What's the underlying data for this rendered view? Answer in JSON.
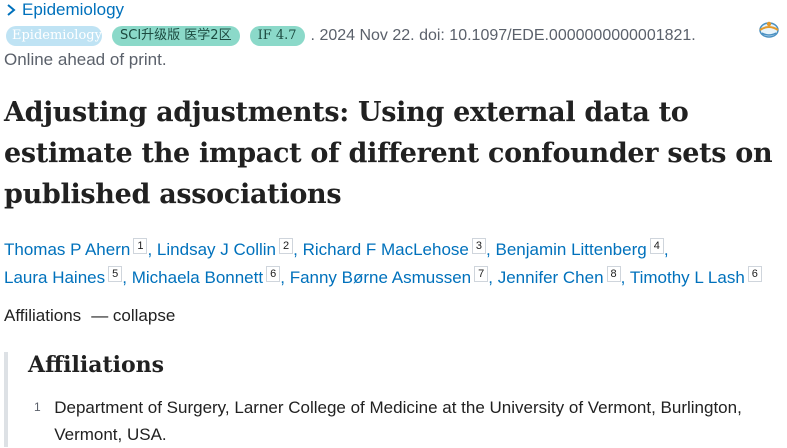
{
  "header": {
    "journal": "Epidemiology",
    "badges": {
      "journal": "Epidemiology",
      "sci": "SCI升级版 医学2区",
      "impact": "IF 4.7"
    },
    "citation": ". 2024 Nov 22. doi: 10.1097/EDE.0000000000001821.",
    "status": "Online ahead of print."
  },
  "article": {
    "title": "Adjusting adjustments: Using external data to estimate the impact of different confounder sets on published associations"
  },
  "authors": [
    {
      "name": "Thomas P Ahern",
      "aff": "1",
      "sep": ","
    },
    {
      "name": "Lindsay J Collin",
      "aff": "2",
      "sep": ","
    },
    {
      "name": "Richard F MacLehose",
      "aff": "3",
      "sep": ","
    },
    {
      "name": "Benjamin Littenberg",
      "aff": "4",
      "sep": ","
    },
    {
      "name": "Laura Haines",
      "aff": "5",
      "sep": ","
    },
    {
      "name": "Michaela Bonnett",
      "aff": "6",
      "sep": ","
    },
    {
      "name": "Fanny Børne Asmussen",
      "aff": "7",
      "sep": ","
    },
    {
      "name": "Jennifer Chen",
      "aff": "8",
      "sep": ","
    },
    {
      "name": "Timothy L Lash",
      "aff": "6",
      "sep": ""
    }
  ],
  "affiliations": {
    "toggle_label": "Affiliations",
    "toggle_control": "— collapse",
    "heading": "Affiliations",
    "items": [
      {
        "num": "1",
        "text": "Department of Surgery, Larner College of Medicine at the University of Vermont, Burlington, Vermont, USA."
      }
    ]
  },
  "icons": {
    "journal_chevron": "chevron-right-icon",
    "cite_tool": "cite-globe-icon"
  },
  "colors": {
    "link": "#0071bc",
    "badge_journal": "#bfe3f4",
    "badge_teal": "#8bd9c9",
    "muted": "#5b616b"
  }
}
